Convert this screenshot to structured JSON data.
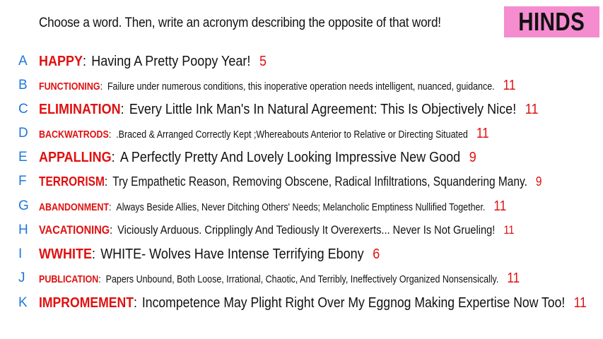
{
  "header": {
    "prompt": "Choose a word. Then, write an acronym describing the opposite of that word!",
    "badge": "HINDS"
  },
  "entries": [
    {
      "letter": "A",
      "word": "HAPPY",
      "acronym": "Having A Pretty Poopy Year!",
      "count": "5"
    },
    {
      "letter": "B",
      "word": "FUNCTIONING",
      "acronym": "Failure under numerous conditions, this inoperative operation needs intelligent, nuanced, guidance.",
      "count": "11"
    },
    {
      "letter": "C",
      "word": "ELIMINATION",
      "acronym": "Every Little Ink Man's In Natural Agreement: This Is Objectively Nice!",
      "count": "11"
    },
    {
      "letter": "D",
      "word": "BACKWATRODS",
      "acronym": ".Braced & Arranged Correctly Kept ;Whereabouts Anterior to Relative or Directing Situated",
      "count": "11"
    },
    {
      "letter": "E",
      "word": "APPALLING",
      "acronym": "A Perfectly Pretty And Lovely Looking Impressive New Good",
      "count": "9"
    },
    {
      "letter": "F",
      "word": "TERRORISM",
      "acronym": "Try Empathetic Reason, Removing Obscene, Radical Infiltrations, Squandering Many.",
      "count": "9"
    },
    {
      "letter": "G",
      "word": "ABANDONMENT",
      "acronym": "Always Beside Allies, Never Ditching Others' Needs; Melancholic Emptiness Nullified Together.",
      "count": "11"
    },
    {
      "letter": "H",
      "word": "VACATIONING",
      "acronym": "Viciously Arduous. Cripplingly And Tediously It Overexerts... Never Is Not Grueling!",
      "count": "11"
    },
    {
      "letter": "I",
      "word": "WWHITE",
      "acronym": "WHITE- Wolves Have Intense Terrifying Ebony",
      "count": "6"
    },
    {
      "letter": "J",
      "word": "PUBLICATION",
      "acronym": "Papers Unbound, Both Loose, Irrational, Chaotic, And Terribly, Ineffectively Organized Nonsensically.",
      "count": "11"
    },
    {
      "letter": "K",
      "word": "IMPROMEMENT",
      "acronym": "Incompetence May Plight Right Over My Eggnog Making Expertise Now Too!",
      "count": "11"
    }
  ]
}
